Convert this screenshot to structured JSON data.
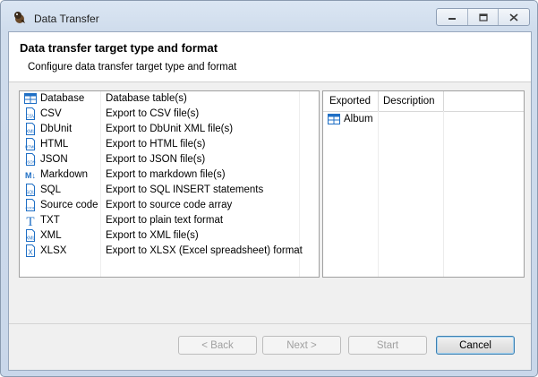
{
  "window": {
    "title": "Data Transfer"
  },
  "header": {
    "title": "Data transfer target type and format",
    "subtitle": "Configure data transfer target type and format"
  },
  "formats": [
    {
      "name": "Database",
      "description": "Database table(s)",
      "icon": "database-table-icon"
    },
    {
      "name": "CSV",
      "description": "Export to CSV file(s)",
      "icon": "csv-file-icon"
    },
    {
      "name": "DbUnit",
      "description": "Export to DbUnit XML file(s)",
      "icon": "xml-file-icon"
    },
    {
      "name": "HTML",
      "description": "Export to HTML file(s)",
      "icon": "html-file-icon"
    },
    {
      "name": "JSON",
      "description": "Export to JSON file(s)",
      "icon": "json-file-icon"
    },
    {
      "name": "Markdown",
      "description": "Export to markdown file(s)",
      "icon": "markdown-icon"
    },
    {
      "name": "SQL",
      "description": "Export to SQL INSERT statements",
      "icon": "sql-file-icon"
    },
    {
      "name": "Source code",
      "description": "Export to source code array",
      "icon": "code-file-icon"
    },
    {
      "name": "TXT",
      "description": "Export to plain text format",
      "icon": "text-t-icon"
    },
    {
      "name": "XML",
      "description": "Export to XML file(s)",
      "icon": "xml-file-icon"
    },
    {
      "name": "XLSX",
      "description": "Export to XLSX (Excel spreadsheet) format",
      "icon": "excel-file-icon"
    }
  ],
  "export_panel": {
    "columns": [
      "Exported",
      "Description"
    ],
    "rows": [
      {
        "name": "Album",
        "description": "",
        "icon": "table-icon"
      }
    ]
  },
  "buttons": {
    "back": "< Back",
    "next": "Next >",
    "start": "Start",
    "cancel": "Cancel"
  },
  "icon_text": {
    "csv": "CSV",
    "xml": "XML",
    "html": "HTML",
    "json": "JSON",
    "sql": "SQL",
    "code": "CODE",
    "markdown": "M↓",
    "txt": "T",
    "xlsx": "X"
  },
  "colors": {
    "icon_blue": "#1f6fc5",
    "title_bar": "#dbe6f3",
    "default_button_border": "#3c7fb1"
  }
}
